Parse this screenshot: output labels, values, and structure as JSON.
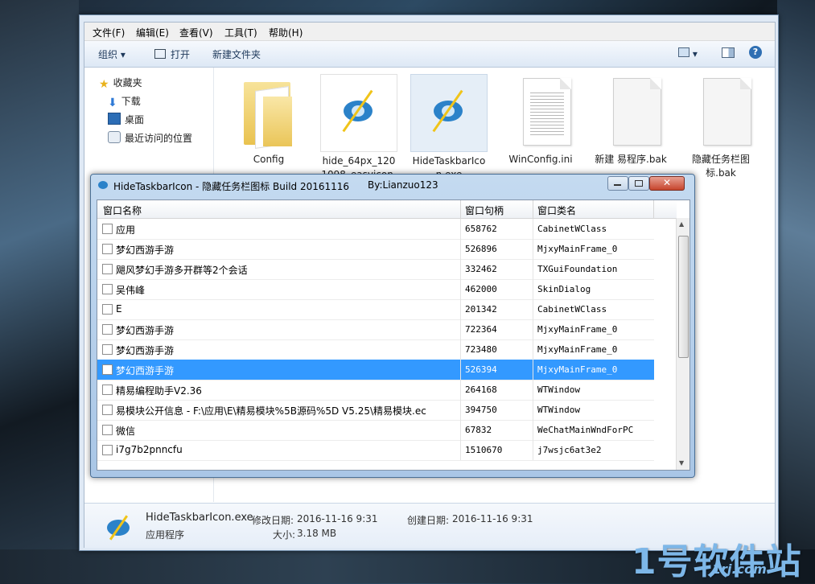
{
  "explorer": {
    "menu": [
      "文件(F)",
      "编辑(E)",
      "查看(V)",
      "工具(T)",
      "帮助(H)"
    ],
    "toolbar": {
      "organize": "组织",
      "open": "打开",
      "new_folder": "新建文件夹"
    },
    "nav": [
      "收藏夹",
      "下载",
      "桌面",
      "最近访问的位置"
    ],
    "files": [
      {
        "name": "Config",
        "icon": "folder-icon"
      },
      {
        "name": "hide_64px_1201098_easyicon.ne",
        "icon": "hide-eye-icon"
      },
      {
        "name": "HideTaskbarIcon.exe",
        "icon": "hide-eye-icon"
      },
      {
        "name": "WinConfig.ini",
        "icon": "text-file-icon"
      },
      {
        "name": "新建 易程序.bak",
        "icon": "blank-file-icon"
      },
      {
        "name": "隐藏任务栏图标.bak",
        "icon": "blank-file-icon"
      }
    ],
    "details": {
      "filename": "HideTaskbarIcon.exe",
      "modified_label": "修改日期:",
      "modified": "2016-11-16 9:31",
      "created_label": "创建日期:",
      "created": "2016-11-16 9:31",
      "type": "应用程序",
      "size_label": "大小:",
      "size": "3.18 MB"
    }
  },
  "dialog": {
    "title": "HideTaskbarIcon - 隐藏任务栏图标 Build 20161116",
    "author": "By:Lianzuo123",
    "columns": [
      "窗口名称",
      "窗口句柄",
      "窗口类名"
    ],
    "rows": [
      {
        "name": "应用",
        "handle": "658762",
        "class": "CabinetWClass",
        "selected": false
      },
      {
        "name": "梦幻西游手游",
        "handle": "526896",
        "class": "MjxyMainFrame_0",
        "selected": false
      },
      {
        "name": "飓风梦幻手游多开群等2个会话",
        "handle": "332462",
        "class": "TXGuiFoundation",
        "selected": false
      },
      {
        "name": "吴伟峰",
        "handle": "462000",
        "class": "SkinDialog",
        "selected": false
      },
      {
        "name": "E",
        "handle": "201342",
        "class": "CabinetWClass",
        "selected": false
      },
      {
        "name": "梦幻西游手游",
        "handle": "722364",
        "class": "MjxyMainFrame_0",
        "selected": false
      },
      {
        "name": "梦幻西游手游",
        "handle": "723480",
        "class": "MjxyMainFrame_0",
        "selected": false
      },
      {
        "name": "梦幻西游手游",
        "handle": "526394",
        "class": "MjxyMainFrame_0",
        "selected": true
      },
      {
        "name": "精易编程助手V2.36",
        "handle": "264168",
        "class": "WTWindow",
        "selected": false
      },
      {
        "name": "易模块公开信息 - F:\\应用\\E\\精易模块%5B源码%5D V5.25\\精易模块.ec",
        "handle": "394750",
        "class": "WTWindow",
        "selected": false
      },
      {
        "name": "微信",
        "handle": "67832",
        "class": "WeChatMainWndForPC",
        "selected": false
      },
      {
        "name": "i7g7b2pnncfu",
        "handle": "1510670",
        "class": "j7wsjc6at3e2",
        "selected": false
      }
    ]
  },
  "watermark": {
    "logo": "1号软件站",
    "url": "1rj.com"
  },
  "colors": {
    "selection": "#3399ff",
    "accent": "#7db7e8"
  }
}
